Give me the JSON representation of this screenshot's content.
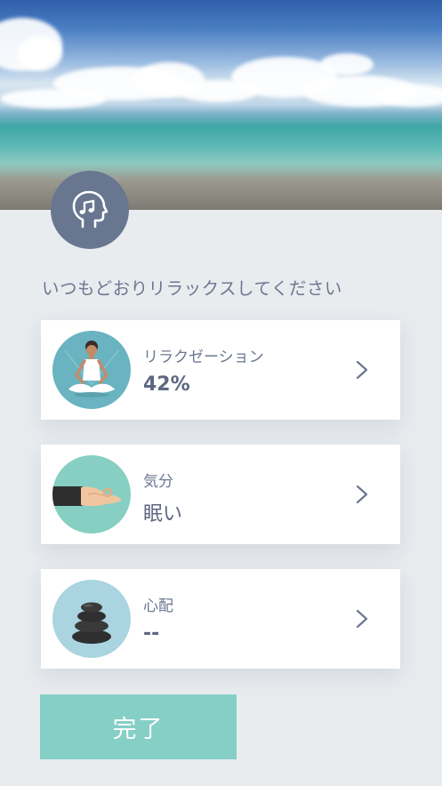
{
  "prompt": "いつもどおりリラックスしてください",
  "cards": [
    {
      "label": "リラクゼーション",
      "value": "42%",
      "icon": "meditation-icon"
    },
    {
      "label": "気分",
      "value": "眠い",
      "icon": "hand-mudra-icon"
    },
    {
      "label": "心配",
      "value": "--",
      "icon": "stacked-stones-icon"
    }
  ],
  "done_button": "完了",
  "colors": {
    "background": "#e8ecef",
    "accent": "#85cfc7",
    "avatar_bg": "#687690",
    "text": "#6c7790"
  }
}
